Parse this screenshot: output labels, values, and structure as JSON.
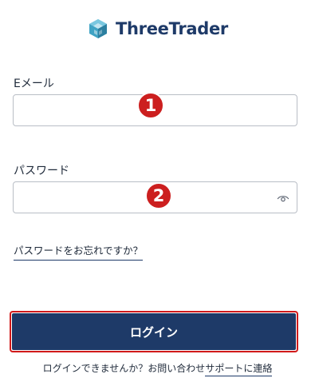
{
  "brand": {
    "name": "ThreeTrader",
    "logo_icon": "cube-logo-icon",
    "colors": {
      "primary": "#1e3a68",
      "accent_teal": "#3fa3c4",
      "annotation_red": "#cc1f1f"
    }
  },
  "form": {
    "email": {
      "label": "Eメール",
      "value": "",
      "placeholder": ""
    },
    "password": {
      "label": "パスワード",
      "value": "",
      "placeholder": "",
      "toggle_icon": "eye-icon"
    },
    "forgot_password_label": "パスワードをお忘れですか？",
    "login_button_label": "ログイン"
  },
  "annotations": {
    "badge_1": "1",
    "badge_2": "2"
  },
  "footer": {
    "help_text": "ログインできませんか？お問い合わせ",
    "support_link_label": "サポートに連絡"
  }
}
